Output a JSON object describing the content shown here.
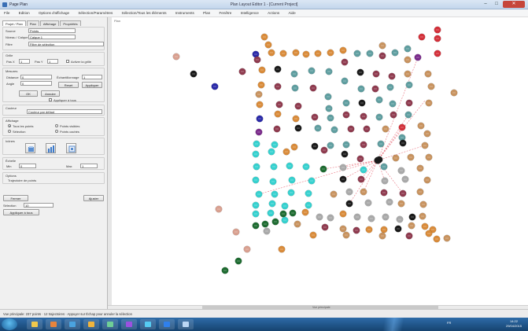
{
  "window": {
    "app_title": "Page Plan",
    "title": "Plan Layout Editor 1 - [Current Project]"
  },
  "menu": {
    "items": [
      "File",
      "Edition",
      "Options d'affichage",
      "Sélection/Paramètres",
      "Sélection/Tous les éléments",
      "Instruments",
      "Plan",
      "Fenêtre",
      "Intelligence",
      "Actions",
      "Aide"
    ]
  },
  "left_panel": {
    "tabs": [
      "Projet / Plan",
      "Plan",
      "Affichage",
      "Propriétés"
    ],
    "source_label": "Source",
    "source_value": "Points",
    "layer_label": "Niveau / Calque",
    "layer_value": "Calque 1",
    "filter_label": "Filtre",
    "filter_value": "Filtre de sélection",
    "grid_label": "Grille",
    "grid_x_label": "Pas X",
    "grid_y_label": "Pas Y",
    "grid_x_value": "1",
    "grid_y_value": "1",
    "grid_enable_label": "Activer la grille",
    "measure_label": "Mesures",
    "distance_label": "Distance",
    "angle_label": "Angle",
    "distance_value": "0",
    "angle_value": "0",
    "sample_label": "Échantillonnage",
    "sample_value": "1",
    "reset_label": "Reset",
    "apply_label": "Appliquer",
    "apply_all_label": "Appliquer à tous",
    "color_label": "Couleur",
    "color_value": "Couleur par défaut",
    "display_label": "Affichage",
    "display_opts": [
      "Tous les points",
      "Points visibles",
      "Sélection",
      "Points cachés"
    ],
    "icon_label": "Icônes",
    "scale_label": "Échelle",
    "scale_min_label": "Min",
    "scale_max_label": "Max",
    "scale_min": "0",
    "scale_max": "1",
    "options_label": "Options",
    "option_value": "Trajectoire de points",
    "ok_label": "OK",
    "cancel_label": "Annuler",
    "close_label": "Fermer",
    "fit_label": "Ajuster",
    "value_box": "10",
    "select_label": "Sélection"
  },
  "canvas": {
    "corner_label": "Plan",
    "scrollbar_label": "Vue principale"
  },
  "status": {
    "text": "Vue principale: 237 points · 12 trajectoires · Appuyer sur Échap pour annuler la sélection"
  },
  "tray": {
    "text": "FR",
    "time": "14:22",
    "date": "29/04/2015"
  },
  "colors": {
    "tan": "#c8935f",
    "orange": "#d98b3a",
    "maroon": "#8f3b4f",
    "teal": "#5f9ea0",
    "black": "#1a1a1a",
    "cyan": "#36d1cf",
    "green": "#1e6b31",
    "gray": "#a9a9a9",
    "red": "#d3303a",
    "blue": "#2a2aa8",
    "purple": "#7b2c8b",
    "salmon": "#d9a090",
    "link": "#e34a5a"
  }
}
